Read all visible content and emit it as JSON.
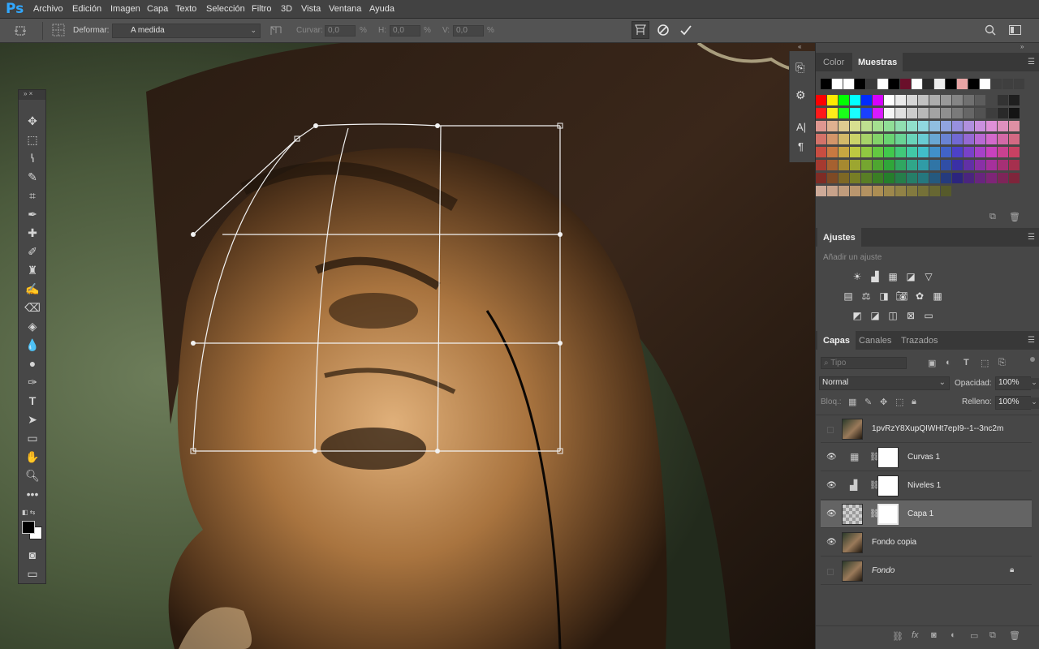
{
  "app": {
    "logo": "Ps"
  },
  "menu": [
    "Archivo",
    "Edición",
    "Imagen",
    "Capa",
    "Texto",
    "Selección",
    "Filtro",
    "3D",
    "Vista",
    "Ventana",
    "Ayuda"
  ],
  "options": {
    "warp_label": "Deformar:",
    "warp_value": "A medida",
    "curve_label": "Curvar:",
    "curve_value": "0,0",
    "h_label": "H:",
    "h_value": "0,0",
    "v_label": "V:",
    "v_value": "0,0",
    "percent": "%"
  },
  "swatch_panel": {
    "tabs": [
      "Color",
      "Muestras"
    ],
    "top_row": [
      "#000000",
      "#ffffff",
      "#ffffff",
      "#000000",
      "#3a3a3a",
      "#ffffff",
      "#000000",
      "#6a0f2a",
      "#ffffff",
      "#2a2a2a",
      "#ededed",
      "#000000",
      "#e8a5a5",
      "#000000",
      "#ffffff",
      "#3f3f3f",
      "#3f3f3f",
      "#3f3f3f"
    ]
  },
  "adjustments": {
    "tab": "Ajustes",
    "hint": "Añadir un ajuste",
    "row1_icons": [
      "brightness-contrast-icon",
      "levels-icon",
      "curves-icon",
      "exposure-icon",
      "vibrance-icon"
    ],
    "row2_icons": [
      "hue-saturation-icon",
      "color-balance-icon",
      "black-white-icon",
      "photo-filter-icon",
      "channel-mixer-icon",
      "color-lookup-icon"
    ],
    "row3_icons": [
      "invert-icon",
      "posterize-icon",
      "threshold-icon",
      "selective-color-icon",
      "gradient-map-icon"
    ]
  },
  "layers_panel": {
    "tabs": [
      "Capas",
      "Canales",
      "Trazados"
    ],
    "filter_placeholder": "Tipo",
    "blend_mode": "Normal",
    "opacity_label": "Opacidad:",
    "opacity_value": "100%",
    "lock_label": "Bloq.:",
    "fill_label": "Relleno:",
    "fill_value": "100%",
    "layers": [
      {
        "name": "1pvRzY8XupQIWHt7epI9--1--3nc2m",
        "visible": false,
        "type": "smart-object"
      },
      {
        "name": "Curvas 1",
        "visible": true,
        "type": "adjustment-curves"
      },
      {
        "name": "Niveles 1",
        "visible": true,
        "type": "adjustment-levels"
      },
      {
        "name": "Capa 1",
        "visible": true,
        "type": "pixel-masked",
        "selected": true
      },
      {
        "name": "Fondo copia",
        "visible": true,
        "type": "pixel"
      },
      {
        "name": "Fondo",
        "visible": false,
        "type": "background",
        "locked": true
      }
    ]
  },
  "colors": {
    "accent": "#31a8ff",
    "panel": "#474747",
    "selected_row": "#646464"
  }
}
